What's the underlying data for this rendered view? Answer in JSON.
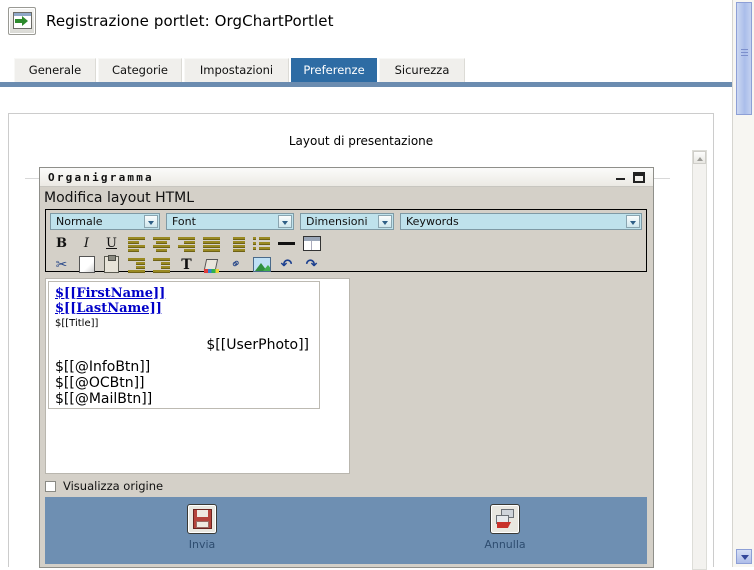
{
  "header": {
    "icon": "portlet-window-export-icon",
    "title": "Registrazione portlet: OrgChartPortlet"
  },
  "tabs": [
    {
      "label": "Generale",
      "active": false
    },
    {
      "label": "Categorie",
      "active": false
    },
    {
      "label": "Impostazioni",
      "active": false
    },
    {
      "label": "Preferenze",
      "active": true
    },
    {
      "label": "Sicurezza",
      "active": false
    }
  ],
  "content": {
    "section_caption": "Layout di presentazione"
  },
  "editor": {
    "window_title": "Organigramma",
    "heading": "Modifica layout HTML",
    "minimize_icon": "minimize-icon",
    "maximize_icon": "maximize-icon",
    "selects": {
      "style": "Normale",
      "font": "Font",
      "size": "Dimensioni",
      "keywords": "Keywords"
    },
    "toolbar_row1": [
      {
        "name": "bold-icon",
        "glyph": "B"
      },
      {
        "name": "italic-icon",
        "glyph": "I"
      },
      {
        "name": "underline-icon",
        "glyph": "U"
      },
      {
        "name": "align-left-icon",
        "glyph": ""
      },
      {
        "name": "align-center-icon",
        "glyph": ""
      },
      {
        "name": "align-right-icon",
        "glyph": ""
      },
      {
        "name": "align-justify-icon",
        "glyph": ""
      },
      {
        "name": "ordered-list-icon",
        "glyph": ""
      },
      {
        "name": "unordered-list-icon",
        "glyph": ""
      },
      {
        "name": "horizontal-rule-icon",
        "glyph": ""
      },
      {
        "name": "insert-table-icon",
        "glyph": ""
      }
    ],
    "toolbar_row2": [
      {
        "name": "cut-icon",
        "glyph": "✂"
      },
      {
        "name": "copy-icon",
        "glyph": ""
      },
      {
        "name": "paste-icon",
        "glyph": ""
      },
      {
        "name": "outdent-icon",
        "glyph": ""
      },
      {
        "name": "indent-icon",
        "glyph": ""
      },
      {
        "name": "text-color-icon",
        "glyph": "T"
      },
      {
        "name": "fill-color-icon",
        "glyph": ""
      },
      {
        "name": "insert-link-icon",
        "glyph": "⚭"
      },
      {
        "name": "insert-image-icon",
        "glyph": ""
      },
      {
        "name": "undo-icon",
        "glyph": "↶"
      },
      {
        "name": "redo-icon",
        "glyph": "↷"
      }
    ],
    "document": {
      "first_name_token": "$[[FirstName]]",
      "last_name_token": "$[[LastName]]",
      "title_token": "$[[Title]]",
      "user_photo_token": "$[[UserPhoto]]",
      "info_button_token": "$[[@InfoBtn]]",
      "oc_button_token": "$[[@OCBtn]]",
      "mail_button_token": "$[[@MailBtn]]"
    },
    "view_source": {
      "label": "Visualizza origine",
      "checked": false
    },
    "actions": [
      {
        "name": "submit-button",
        "label": "Invia",
        "icon": "floppy-save-icon"
      },
      {
        "name": "cancel-button",
        "label": "Annulla",
        "icon": "undo-cancel-icon"
      }
    ]
  },
  "scrollbars": {
    "page_scrollbar_down_icon": "chevron-down-icon",
    "inner_scrollbar_up_icon": "chevron-up-icon"
  },
  "colors": {
    "accent_blue": "#2e6ca4",
    "rule_blue": "#6b8cb0",
    "action_bar": "#6e8fb2",
    "editor_chrome": "#d4d0c8",
    "select_fill": "#bfe2ec",
    "link_blue": "#0000c8"
  }
}
